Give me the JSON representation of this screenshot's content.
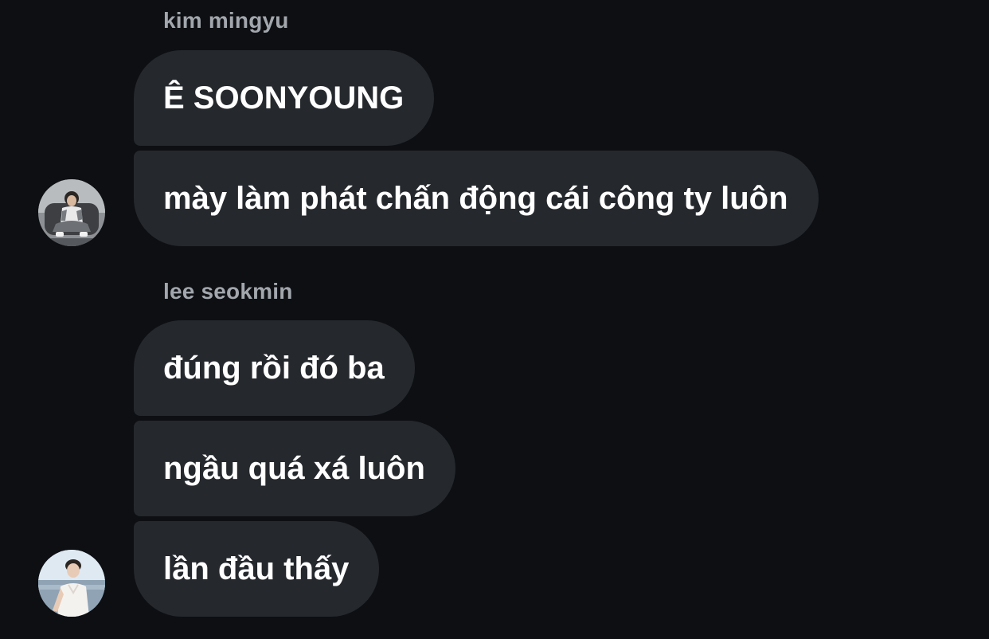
{
  "conversation": {
    "groups": [
      {
        "sender": "kim mingyu",
        "avatar_icon": "user-photo-seated-icon",
        "messages": [
          "Ê SOONYOUNG",
          "mày làm phát chấn động cái công ty luôn"
        ]
      },
      {
        "sender": "lee seokmin",
        "avatar_icon": "user-photo-beach-icon",
        "messages": [
          "đúng rồi đó ba",
          "ngầu quá xá luôn",
          "lần đầu thấy"
        ]
      }
    ]
  },
  "colors": {
    "background": "#0d0f13",
    "bubble": "#25282d",
    "sender_name": "#a2a6ad",
    "message_text": "#ffffff"
  }
}
